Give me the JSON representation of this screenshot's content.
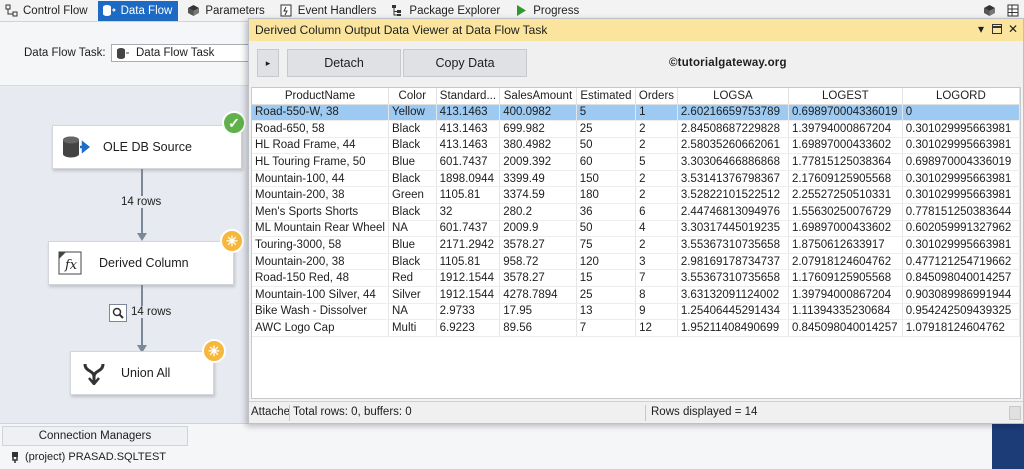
{
  "toolbar": {
    "tabs": [
      {
        "label": "Control Flow",
        "icon": "control-flow-icon"
      },
      {
        "label": "Data Flow",
        "icon": "data-flow-icon"
      },
      {
        "label": "Parameters",
        "icon": "parameters-icon"
      },
      {
        "label": "Event Handlers",
        "icon": "event-handlers-icon"
      },
      {
        "label": "Package Explorer",
        "icon": "package-explorer-icon"
      },
      {
        "label": "Progress",
        "icon": "progress-icon"
      }
    ],
    "active_tab": "Data Flow",
    "accent_color": "#1c6ac3"
  },
  "task": {
    "label": "Data Flow Task:",
    "value": "Data Flow Task"
  },
  "canvas": {
    "components": [
      {
        "label": "OLE DB Source",
        "icon": "database-source-icon",
        "status": "check-icon"
      },
      {
        "label": "Derived Column",
        "icon": "fx-icon",
        "status": "warning-icon"
      },
      {
        "label": "Union All",
        "icon": "merge-icon",
        "status": "warning-icon"
      }
    ],
    "paths": [
      {
        "label": "14 rows"
      },
      {
        "label": "14 rows",
        "icon": "data-viewer-icon"
      }
    ]
  },
  "viewer": {
    "title": "Derived Column Output Data Viewer at Data Flow Task",
    "title_bar_color": "#fbe49d",
    "buttons": {
      "detach": "Detach",
      "copy": "Copy Data"
    },
    "brand": "©tutorialgateway.org",
    "columns": [
      "ProductName",
      "Color",
      "Standard...",
      "SalesAmount",
      "Estimated",
      "Orders",
      "LOGSA",
      "LOGEST",
      "LOGORD"
    ],
    "rows": [
      [
        "Road-550-W, 38",
        "Yellow",
        "413.1463",
        "400.0982",
        "5",
        "1",
        "2.60216659753789",
        "0.698970004336019",
        "0"
      ],
      [
        "Road-650, 58",
        "Black",
        "413.1463",
        "699.982",
        "25",
        "2",
        "2.84508687229828",
        "1.39794000867204",
        "0.301029995663981"
      ],
      [
        "HL Road Frame, 44",
        "Black",
        "413.1463",
        "380.4982",
        "50",
        "2",
        "2.58035260662061",
        "1.69897000433602",
        "0.301029995663981"
      ],
      [
        "HL Touring Frame, 50",
        "Blue",
        "601.7437",
        "2009.392",
        "60",
        "5",
        "3.30306466886868",
        "1.77815125038364",
        "0.698970004336019"
      ],
      [
        "Mountain-100, 44",
        "Black",
        "1898.0944",
        "3399.49",
        "150",
        "2",
        "3.53141376798367",
        "2.17609125905568",
        "0.301029995663981"
      ],
      [
        "Mountain-200, 38",
        "Green",
        "1105.81",
        "3374.59",
        "180",
        "2",
        "3.52822101522512",
        "2.25527250510331",
        "0.301029995663981"
      ],
      [
        "Men's Sports Shorts",
        "Black",
        "32",
        "280.2",
        "36",
        "6",
        "2.44746813094976",
        "1.55630250076729",
        "0.778151250383644"
      ],
      [
        "ML Mountain Rear Wheel",
        "NA",
        "601.7437",
        "2009.9",
        "50",
        "4",
        "3.30317445019235",
        "1.69897000433602",
        "0.602059991327962"
      ],
      [
        "Touring-3000, 58",
        "Blue",
        "2171.2942",
        "3578.27",
        "75",
        "2",
        "3.55367310735658",
        "1.8750612633917",
        "0.301029995663981"
      ],
      [
        "Mountain-200, 38",
        "Black",
        "1105.81",
        "958.72",
        "120",
        "3",
        "2.98169178734737",
        "2.07918124604762",
        "0.477121254719662"
      ],
      [
        "Road-150 Red, 48",
        "Red",
        "1912.1544",
        "3578.27",
        "15",
        "7",
        "3.55367310735658",
        "1.17609125905568",
        "0.845098040014257"
      ],
      [
        "Mountain-100 Silver, 44",
        "Silver",
        "1912.1544",
        "4278.7894",
        "25",
        "8",
        "3.63132091124002",
        "1.39794000867204",
        "0.903089986991944"
      ],
      [
        "Bike Wash - Dissolver",
        "NA",
        "2.9733",
        "17.95",
        "13",
        "9",
        "1.25406445291434",
        "1.11394335230684",
        "0.954242509439325"
      ],
      [
        "AWC Logo Cap",
        "Multi",
        "6.9223",
        "89.56",
        "7",
        "12",
        "1.95211408490699",
        "0.845098040014257",
        "1.07918124604762"
      ]
    ],
    "selected_row_color": "#9ccaf2",
    "status": {
      "attached": "Attache",
      "totals": "Total rows: 0, buffers: 0",
      "displayed": "Rows displayed = 14"
    }
  },
  "connections": {
    "tab": "Connection Managers",
    "items": [
      "(project) PRASAD.SQLTEST"
    ]
  }
}
